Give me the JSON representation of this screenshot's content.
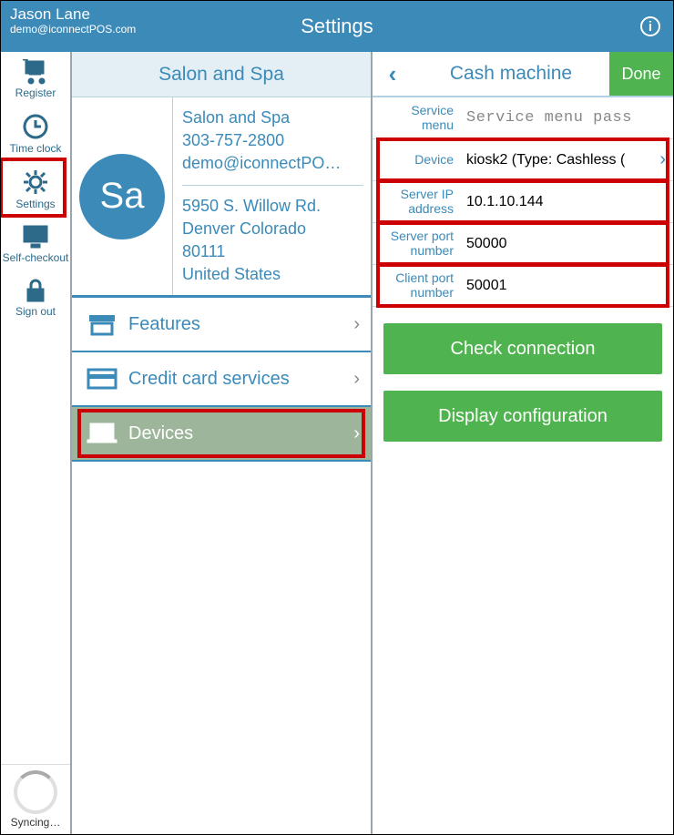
{
  "header": {
    "user_name": "Jason Lane",
    "user_email": "demo@iconnectPOS.com",
    "title": "Settings"
  },
  "leftnav": {
    "items": [
      {
        "label": "Register",
        "icon": "cart"
      },
      {
        "label": "Time clock",
        "icon": "clock"
      },
      {
        "label": "Settings",
        "icon": "gear",
        "highlighted": true
      },
      {
        "label": "Self-checkout",
        "icon": "monitor"
      },
      {
        "label": "Sign out",
        "icon": "lock"
      }
    ],
    "syncing_label": "Syncing…"
  },
  "middle": {
    "title": "Salon and Spa",
    "org": {
      "avatar_initials": "Sa",
      "name": "Salon and Spa",
      "phone": "303-757-2800",
      "email": "demo@iconnectPO…",
      "address1": "5950 S. Willow Rd.",
      "city_state": "Denver Colorado",
      "zip": "80111",
      "country": "United States"
    },
    "menu": [
      {
        "label": "Features",
        "icon": "archive"
      },
      {
        "label": "Credit card services",
        "icon": "card"
      },
      {
        "label": "Devices",
        "icon": "laptop",
        "selected": true,
        "highlighted": true
      }
    ]
  },
  "right": {
    "title": "Cash machine",
    "done_label": "Done",
    "fields": [
      {
        "label": "Service menu password",
        "value": "",
        "placeholder": "Service menu pass"
      },
      {
        "label": "Device",
        "value": "kiosk2 (Type: Cashless (",
        "chevron": true,
        "redbox": true
      },
      {
        "label": "Server IP address",
        "value": "10.1.10.144",
        "redbox": true
      },
      {
        "label": "Server port number",
        "value": "50000",
        "redbox": true
      },
      {
        "label": "Client port number",
        "value": "50001",
        "redbox": true
      }
    ],
    "buttons": {
      "check_connection": "Check connection",
      "display_configuration": "Display configuration"
    }
  }
}
